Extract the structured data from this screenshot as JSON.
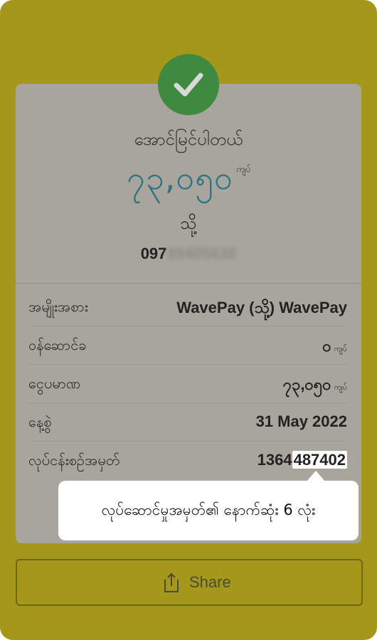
{
  "receipt": {
    "status": "အောင်မြင်ပါတယ်",
    "amount": "၇၃,၀၅၀",
    "amount_unit": "ကျပ်",
    "to_label": "သို့",
    "phone_visible": "097",
    "phone_blurred": "89405638",
    "rows": [
      {
        "label": "အမျိုးအစား",
        "value": "WavePay (သို့) WavePay"
      },
      {
        "label": "ဝန်ဆောင်ခ",
        "value": "၀",
        "unit": "ကျပ်"
      },
      {
        "label": "ငွေပမာဏ",
        "value": "၇၃,၀၅၀",
        "unit": "ကျပ်"
      },
      {
        "label": "နေ့စွဲ",
        "value": "31 May 2022"
      },
      {
        "label": "လုပ်ငန်းစဉ်အမှတ်",
        "value_prefix": "1364",
        "value_highlight": "487402"
      }
    ]
  },
  "tooltip": {
    "text": "လုပ်ဆောင်မှုအမှတ်၏ နောက်ဆုံး 6 လုံး"
  },
  "share": {
    "label": "Share"
  },
  "colors": {
    "overlay": "#a49719",
    "success": "#3e8a40",
    "amount": "#2d7386"
  }
}
